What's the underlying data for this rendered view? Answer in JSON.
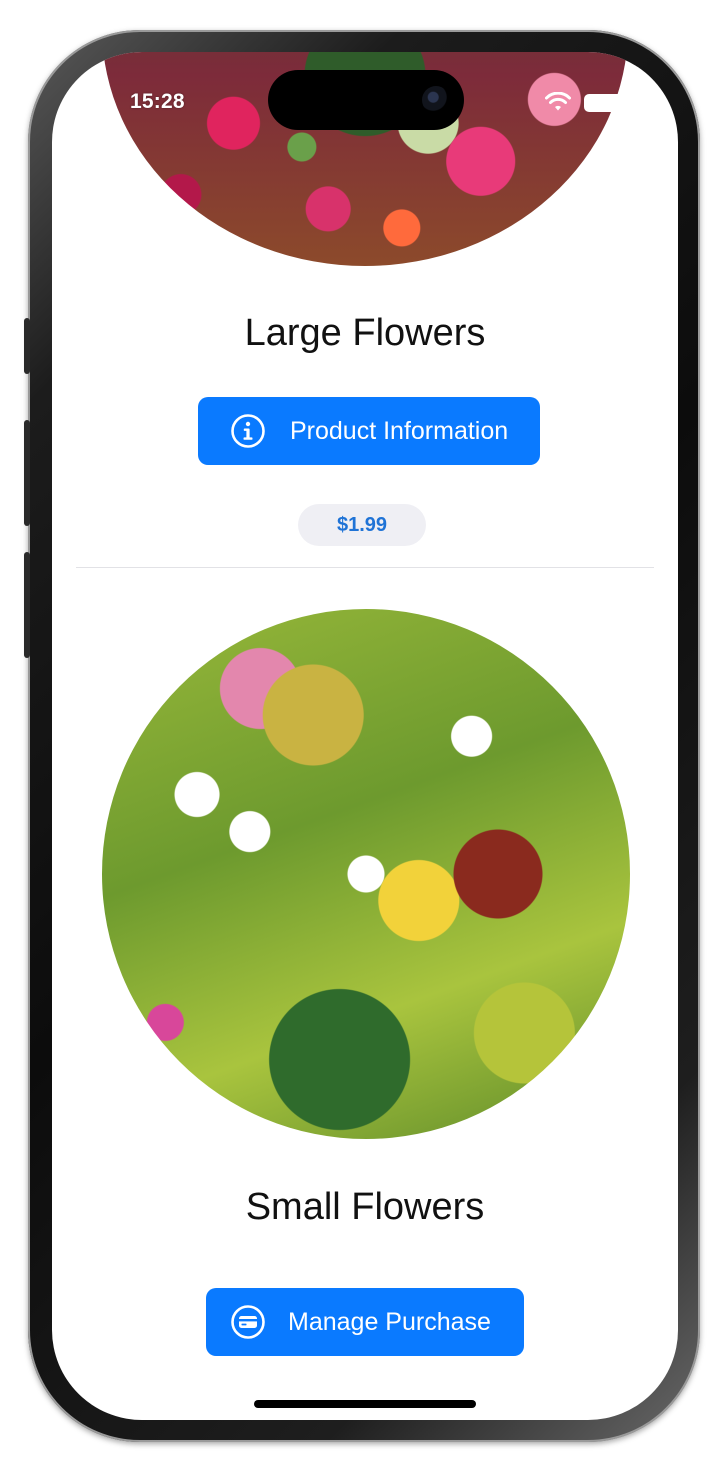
{
  "status_bar": {
    "time": "15:28",
    "icons": [
      "wifi-icon",
      "battery-icon"
    ]
  },
  "products": [
    {
      "title": "Large Flowers",
      "button_label": "Product Information",
      "button_icon": "info-circle-icon",
      "price": "$1.99"
    },
    {
      "title": "Small Flowers",
      "button_label": "Manage Purchase",
      "button_icon": "credit-card-icon"
    }
  ],
  "colors": {
    "accent": "#0a7aff",
    "price_text": "#1f73d6",
    "pill_background": "#efeff4"
  }
}
